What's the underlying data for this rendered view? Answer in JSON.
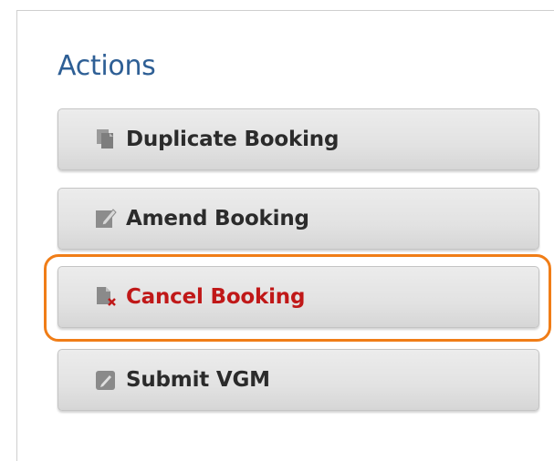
{
  "panel": {
    "heading": "Actions"
  },
  "actions": [
    {
      "label": "Duplicate Booking",
      "icon": "duplicate-icon"
    },
    {
      "label": "Amend Booking",
      "icon": "amend-icon"
    },
    {
      "label": "Cancel Booking",
      "icon": "cancel-document-icon",
      "color": "#c01818",
      "highlighted": true
    },
    {
      "label": "Submit VGM",
      "icon": "submit-edit-icon"
    }
  ],
  "colors": {
    "heading": "#2e5f95",
    "highlight": "#f07d17",
    "icon": "#8a8a8a",
    "cancel_mark": "#c01818"
  }
}
